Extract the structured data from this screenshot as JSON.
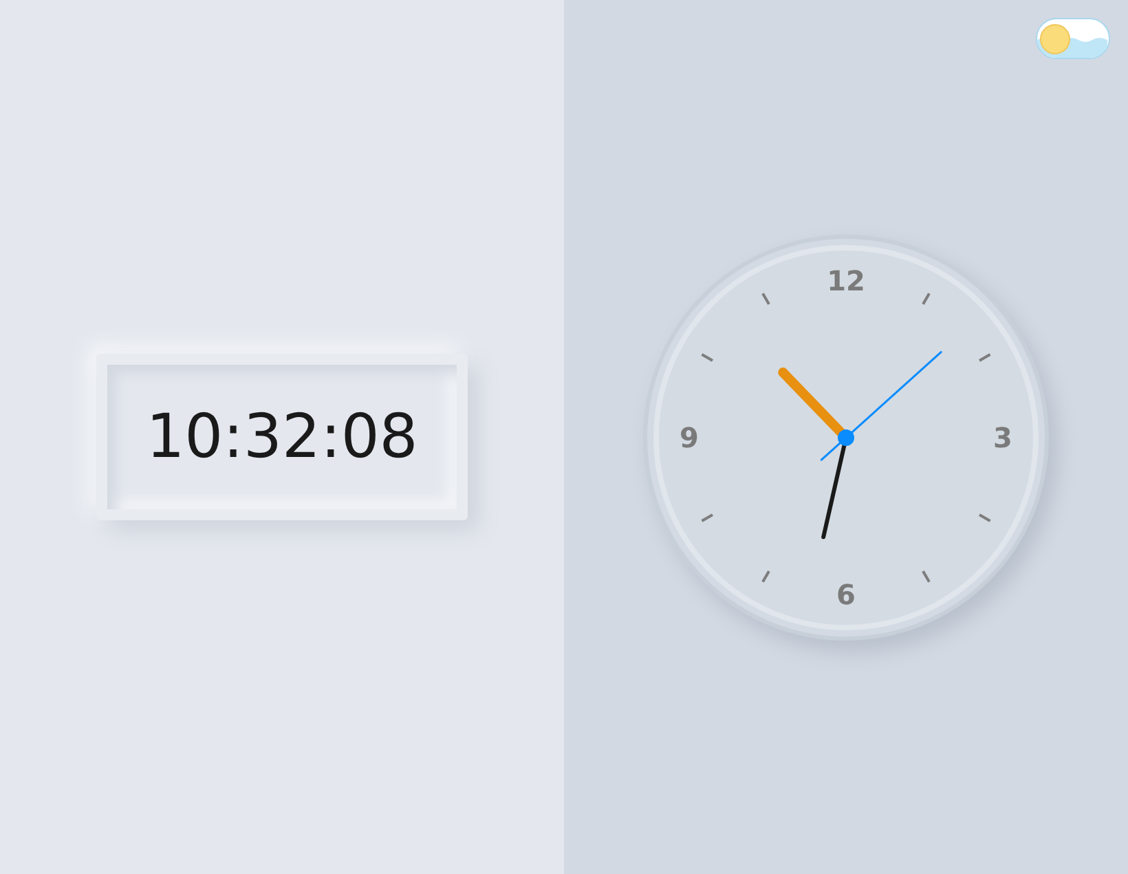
{
  "digital_clock": {
    "time": "10:32:08"
  },
  "analog_clock": {
    "numbers": [
      {
        "label": "12"
      },
      {
        "label": "3"
      },
      {
        "label": "6"
      },
      {
        "label": "9"
      }
    ]
  },
  "theme_toggle": {
    "on": false
  }
}
